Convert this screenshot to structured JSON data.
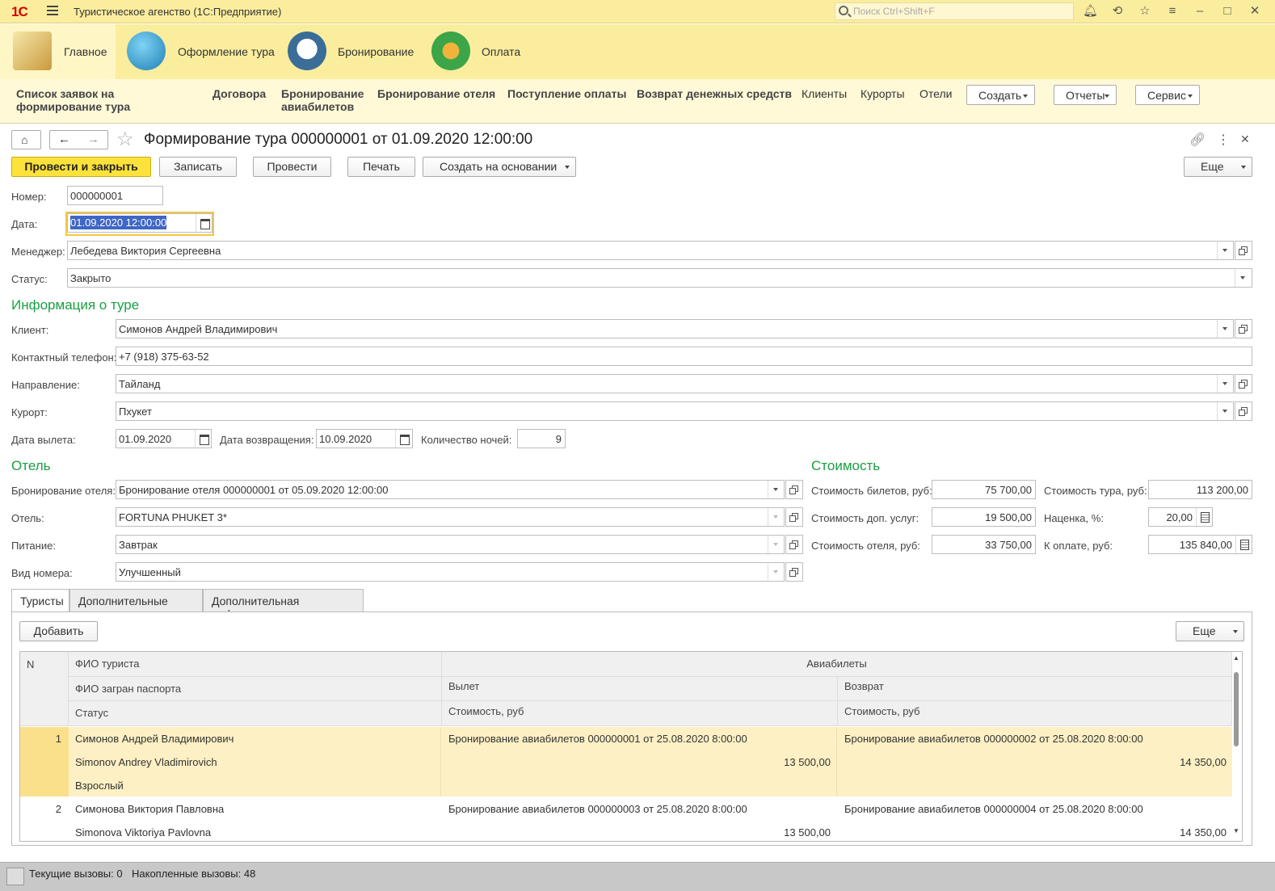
{
  "titlebar": {
    "logo": "1С",
    "app_title": "Туристическое агенство  (1С:Предприятие)",
    "search_placeholder": "Поиск Ctrl+Shift+F"
  },
  "sections": [
    {
      "label": "Главное",
      "icon": "desk-lamp-icon"
    },
    {
      "label": "Оформление тура",
      "icon": "beach-icon"
    },
    {
      "label": "Бронирование",
      "icon": "calendar-icon"
    },
    {
      "label": "Оплата",
      "icon": "wallet-icon"
    }
  ],
  "nav": {
    "items": [
      "Список заявок на формирование тура",
      "Договора",
      "Бронирование авиабилетов",
      "Бронирование отеля",
      "Поступление оплаты",
      "Возврат денежных средств",
      "Клиенты",
      "Курорты",
      "Отели"
    ],
    "buttons": [
      "Создать",
      "Отчеты",
      "Сервис"
    ]
  },
  "form": {
    "title": "Формирование тура 000000001 от 01.09.2020 12:00:00",
    "buttons": {
      "post_close": "Провести и закрыть",
      "save": "Записать",
      "post": "Провести",
      "print": "Печать",
      "create_based": "Создать на основании",
      "more": "Еще"
    },
    "labels": {
      "number": "Номер:",
      "date": "Дата:",
      "manager": "Менеджер:",
      "status": "Статус:",
      "client": "Клиент:",
      "phone": "Контактный телефон:",
      "direction": "Направление:",
      "resort": "Курорт:",
      "depart": "Дата вылета:",
      "return": "Дата возвращения:",
      "nights": "Количество ночей:",
      "hotel_booking": "Бронирование отеля:",
      "hotel": "Отель:",
      "meals": "Питание:",
      "room": "Вид номера:",
      "tickets_cost": "Стоимость билетов, руб:",
      "extra_cost": "Стоимость доп. услуг:",
      "hotel_cost": "Стоимость отеля, руб:",
      "tour_cost": "Стоимость тура, руб:",
      "markup": "Наценка, %:",
      "to_pay": "К оплате, руб:"
    },
    "values": {
      "number": "000000001",
      "date": "01.09.2020 12:00:00",
      "manager": "Лебедева Виктория Сергеевна",
      "status": "Закрыто",
      "client": "Симонов Андрей Владимирович",
      "phone": "+7 (918) 375-63-52",
      "direction": "Тайланд",
      "resort": "Пхукет",
      "depart": "01.09.2020",
      "return": "10.09.2020",
      "nights": "9",
      "hotel_booking": "Бронирование отеля 000000001 от 05.09.2020 12:00:00",
      "hotel": "FORTUNA PHUKET 3*",
      "meals": "Завтрак",
      "room": "Улучшенный",
      "tickets_cost": "75 700,00",
      "extra_cost": "19 500,00",
      "hotel_cost": "33 750,00",
      "tour_cost": "113 200,00",
      "markup": "20,00",
      "to_pay": "135 840,00"
    },
    "groups": {
      "tour_info": "Информация о туре",
      "hotel": "Отель",
      "cost": "Стоимость"
    }
  },
  "tabs": [
    "Туристы",
    "Дополнительные услуги",
    "Дополнительная информация"
  ],
  "table": {
    "add": "Добавить",
    "more": "Еще",
    "headers": {
      "n": "N",
      "fio": "ФИО туриста",
      "passport": "ФИО загран паспорта",
      "status": "Статус",
      "tickets": "Авиабилеты",
      "depart": "Вылет",
      "return": "Возврат",
      "cost1": "Стоимость, руб",
      "cost2": "Стоимость, руб"
    },
    "rows": [
      {
        "n": "1",
        "fio": "Симонов Андрей Владимирович",
        "passport": "Simonov Andrey Vladimirovich",
        "status": "Взрослый",
        "depart": "Бронирование авиабилетов 000000001 от 25.08.2020 8:00:00",
        "depart_cost": "13 500,00",
        "return": "Бронирование авиабилетов 000000002 от 25.08.2020 8:00:00",
        "return_cost": "14 350,00"
      },
      {
        "n": "2",
        "fio": "Симонова Виктория Павловна",
        "passport": "Simonova Viktoriya Pavlovna",
        "status": "",
        "depart": "Бронирование авиабилетов 000000003 от 25.08.2020 8:00:00",
        "depart_cost": "13 500,00",
        "return": "Бронирование авиабилетов 000000004 от 25.08.2020 8:00:00",
        "return_cost": "14 350,00"
      }
    ]
  },
  "statusbar": {
    "current": "Текущие вызовы: 0",
    "accumulated": "Накопленные вызовы: 48"
  }
}
